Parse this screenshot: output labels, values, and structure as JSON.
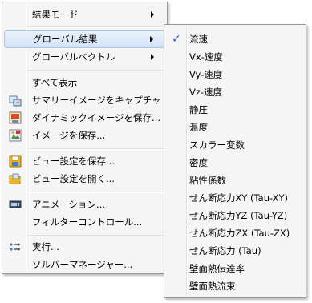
{
  "main_menu": {
    "items": [
      {
        "label": "結果モード",
        "submenu": true
      },
      {
        "label": "グローバル結果",
        "submenu": true,
        "highlighted": true
      },
      {
        "label": "グローバルベクトル",
        "submenu": true
      },
      {
        "label": "すべて表示"
      },
      {
        "label": "サマリーイメージをキャプチャ",
        "icon": "capture-icon"
      },
      {
        "label": "ダイナミックイメージを保存...",
        "icon": "dynamic-image-icon"
      },
      {
        "label": "イメージを保存...",
        "icon": "save-image-icon"
      },
      {
        "label": "ビュー設定を保存...",
        "icon": "save-view-icon"
      },
      {
        "label": "ビュー設定を開く...",
        "icon": "open-view-icon"
      },
      {
        "label": "アニメーション...",
        "icon": "animation-icon"
      },
      {
        "label": "フィルターコントロール..."
      },
      {
        "label": "実行...",
        "icon": "run-icon"
      },
      {
        "label": "ソルバーマネージャー..."
      }
    ]
  },
  "sub_menu": {
    "items": [
      {
        "label": "流速",
        "checked": true
      },
      {
        "label": "Vx-速度"
      },
      {
        "label": "Vy-速度"
      },
      {
        "label": "Vz-速度"
      },
      {
        "label": "静圧"
      },
      {
        "label": "温度"
      },
      {
        "label": "スカラー変数"
      },
      {
        "label": "密度"
      },
      {
        "label": "粘性係数"
      },
      {
        "label": "せん断応力XY (Tau-XY)"
      },
      {
        "label": "せん断応力YZ (Tau-YZ)"
      },
      {
        "label": "せん断応力ZX (Tau-ZX)"
      },
      {
        "label": "せん断応力 (Tau)"
      },
      {
        "label": "壁面熱伝達率"
      },
      {
        "label": "壁面熱流束"
      }
    ]
  },
  "colors": {
    "highlight_border": "#a8c8ea",
    "check": "#2a5ec7"
  },
  "glyphs": {
    "check": "✓"
  }
}
